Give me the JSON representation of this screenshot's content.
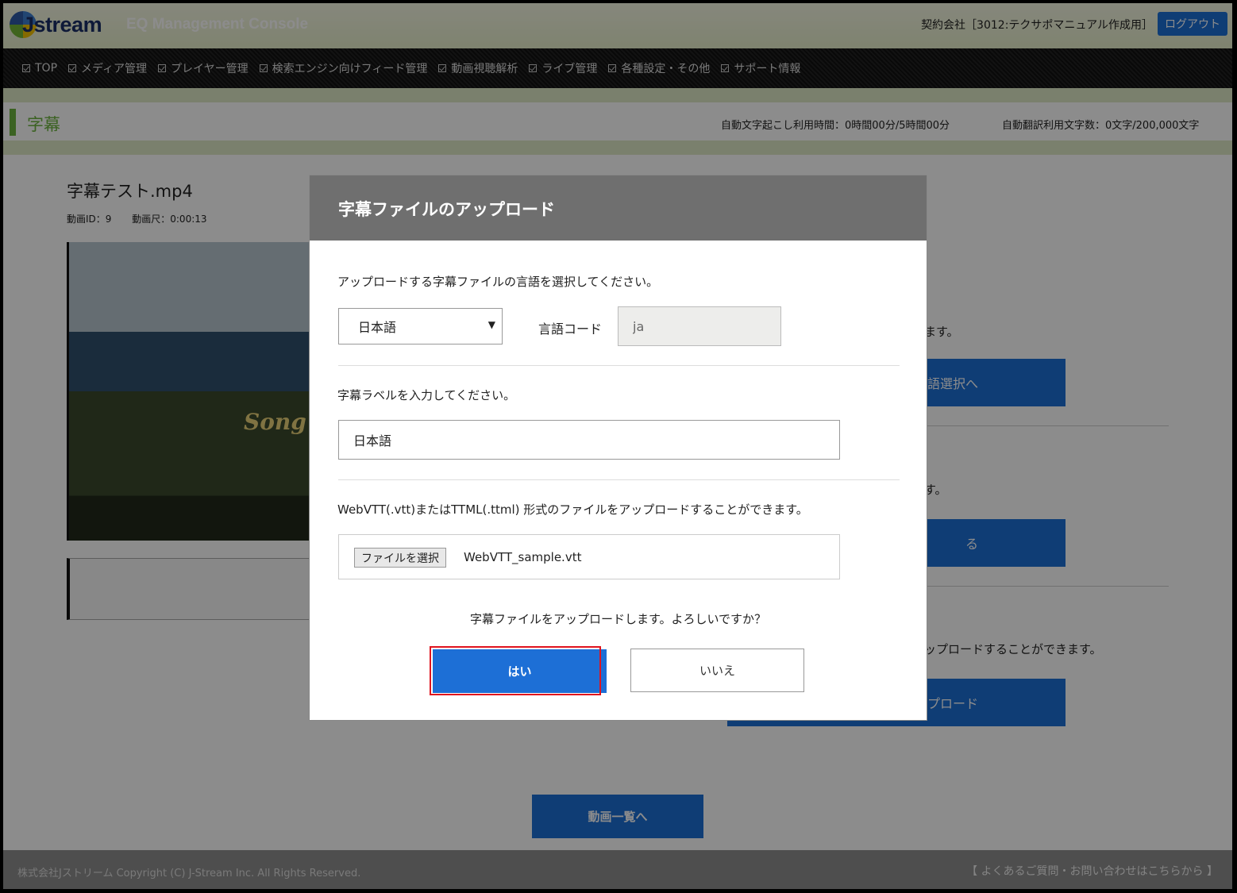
{
  "header": {
    "logo_text": "Jstream",
    "console_title": "EQ Management Console",
    "contract": "契約会社［3012:テクサポマニュアル作成用］",
    "logout_label": "ログアウト"
  },
  "nav": {
    "items": [
      {
        "label": "TOP"
      },
      {
        "label": "メディア管理"
      },
      {
        "label": "プレイヤー管理"
      },
      {
        "label": "検索エンジン向けフィード管理"
      },
      {
        "label": "動画視聴解析"
      },
      {
        "label": "ライブ管理"
      },
      {
        "label": "各種設定・その他"
      },
      {
        "label": "サポート情報"
      }
    ]
  },
  "page": {
    "title": "字幕",
    "usage_transcription": "自動文字起こし利用時間：0時間00分/5時間00分",
    "usage_translation": "自動翻訳利用文字数：0文字/200,000文字"
  },
  "video": {
    "title": "字幕テスト.mp4",
    "id_label": "動画ID：9",
    "duration_label": "動画尺：0:00:13",
    "thumb_caption": "Song"
  },
  "background": {
    "text_1": "ます。",
    "button_1": "語選択へ",
    "text_2": "す。",
    "button_2": "る",
    "text_3": "ップロードすることができます。",
    "button_3": "プロード",
    "back_button": "動画一覧へ"
  },
  "footer": {
    "copyright": "株式会社Jストリーム Copyright (C) J-Stream Inc. All Rights Reserved.",
    "faq": "【 よくあるご質問・お問い合わせはこちらから 】"
  },
  "modal": {
    "title": "字幕ファイルのアップロード",
    "language_prompt": "アップロードする字幕ファイルの言語を選択してください。",
    "language_selected": "日本語",
    "language_code_label": "言語コード",
    "language_code_value": "ja",
    "label_prompt": "字幕ラベルを入力してください。",
    "label_value": "日本語",
    "file_prompt": "WebVTT(.vtt)またはTTML(.ttml) 形式のファイルをアップロードすることができます。",
    "file_button": "ファイルを選択",
    "file_name": "WebVTT_sample.vtt",
    "confirm_text": "字幕ファイルをアップロードします。よろしいですか？",
    "yes_label": "はい",
    "no_label": "いいえ"
  }
}
